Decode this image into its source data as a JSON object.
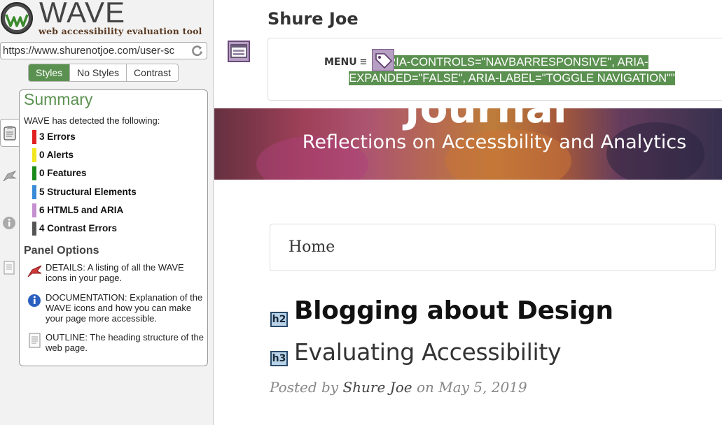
{
  "wave": {
    "logo_text": "WAVE",
    "tagline": "web accessibility evaluation tool",
    "url": "https://www.shurenotjoe.com/user-sc",
    "view_tabs": [
      {
        "label": "Styles",
        "active": true
      },
      {
        "label": "No Styles",
        "active": false
      },
      {
        "label": "Contrast",
        "active": false
      }
    ],
    "summary": {
      "title": "Summary",
      "intro": "WAVE has detected the following:",
      "rows": [
        {
          "label": "3 Errors",
          "color": "#e02020"
        },
        {
          "label": "0 Alerts",
          "color": "#f2e620"
        },
        {
          "label": "0 Features",
          "color": "#1a8a1a"
        },
        {
          "label": "5 Structural Elements",
          "color": "#3a8ad8"
        },
        {
          "label": "6 HTML5 and ARIA",
          "color": "#c590d0"
        },
        {
          "label": "4 Contrast Errors",
          "color": "#555555"
        }
      ],
      "panel_options_title": "Panel Options",
      "options": [
        {
          "icon": "flag-icon",
          "text": "DETAILS: A listing of all the WAVE icons in your page."
        },
        {
          "icon": "info-icon",
          "text": "DOCUMENTATION: Explanation of the WAVE icons and how you can make your page more accessible."
        },
        {
          "icon": "document-icon",
          "text": "OUTLINE: The heading structure of the web page."
        }
      ]
    }
  },
  "page": {
    "site_title": "Shure Joe",
    "menu_label": "MENU",
    "menu_icon": "≡",
    "aria_annotation": "\"ARIA-CONTROLS=\"NAVBARRESPONSIVE\", ARIA-EXPANDED=\"FALSE\", ARIA-LABEL=\"TOGGLE NAVIGATION\"\"",
    "hero_partial_title": "Journal",
    "hero_tagline": "Reflections on Accessbility and Analytics",
    "breadcrumb": "Home",
    "h2_badge": "h2",
    "h2": "Blogging about Design",
    "h3_badge": "h3",
    "h3": "Evaluating Accessibility",
    "posted_prefix": "Posted by",
    "author": "Shure Joe",
    "posted_on": "on",
    "date": "May 5, 2019"
  },
  "colors": {
    "wave_green": "#5b9150",
    "aria_purple": "#b79fc4"
  }
}
